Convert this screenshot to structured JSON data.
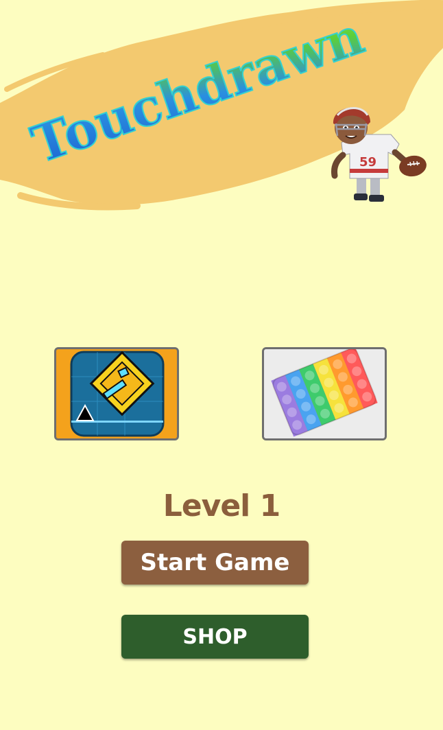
{
  "app": {
    "title": "Touchdrawn"
  },
  "mascot": {
    "jersey_number": "59",
    "icon": "football-player-mascot"
  },
  "game_cards": [
    {
      "icon": "geometry-dash-cube-icon"
    },
    {
      "icon": "rainbow-pop-it-icon"
    }
  ],
  "level": {
    "label": "Level 1"
  },
  "buttons": {
    "start_label": "Start Game",
    "shop_label": "SHOP"
  },
  "colors": {
    "background": "#fdfdc0",
    "banner_brush": "#f3c96f",
    "level_text": "#8b5e3c",
    "start_button": "#8c5f3f",
    "shop_button": "#2e5e2c"
  }
}
